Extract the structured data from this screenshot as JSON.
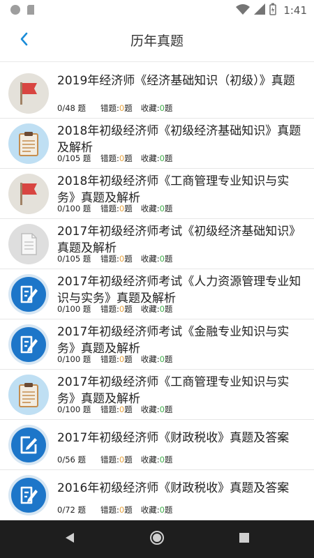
{
  "status": {
    "time": "1:41"
  },
  "header": {
    "title": "历年真题",
    "back_icon": "chevron-left-icon"
  },
  "colors": {
    "accent": "#1a8cd8",
    "wrong": "#e6a23c",
    "fav": "#3fae49",
    "badge_blue": "#1d76c9"
  },
  "labels": {
    "wrong": "错题:",
    "fav": "收藏:",
    "unit": "题"
  },
  "items": [
    {
      "icon": "flag-icon",
      "title": "2019年经济师《经济基础知识（初级）》真题",
      "count": "0/48 题",
      "wrong": "0",
      "fav": "0"
    },
    {
      "icon": "clipboard-icon",
      "title": "2018年初级经济师《初级经济基础知识》真题及解析",
      "count": "0/105 题",
      "wrong": "0",
      "fav": "0"
    },
    {
      "icon": "flag-icon",
      "title": "2018年初级经济师《工商管理专业知识与实务》真题及解析",
      "count": "0/100 题",
      "wrong": "0",
      "fav": "0"
    },
    {
      "icon": "document-icon",
      "title": "2017年初级经济师考试《初级经济基础知识》真题及解析",
      "count": "0/105 题",
      "wrong": "0",
      "fav": "0"
    },
    {
      "icon": "edit-icon",
      "title": "2017年初级经济师考试《人力资源管理专业知识与实务》真题及解析",
      "count": "0/100 题",
      "wrong": "0",
      "fav": "0"
    },
    {
      "icon": "edit-icon",
      "title": "2017年初级经济师考试《金融专业知识与实务》真题及解析",
      "count": "0/100 题",
      "wrong": "0",
      "fav": "0"
    },
    {
      "icon": "clipboard-icon",
      "title": "2017年初级经济师《工商管理专业知识与实务》真题及解析",
      "count": "0/100 题",
      "wrong": "0",
      "fav": "0"
    },
    {
      "icon": "edit-square-icon",
      "title": "2017年初级经济师《财政税收》真题及答案",
      "count": "0/56 题",
      "wrong": "0",
      "fav": "0"
    },
    {
      "icon": "edit-icon",
      "title": "2016年初级经济师《财政税收》真题及答案",
      "count": "0/72 题",
      "wrong": "0",
      "fav": "0"
    }
  ]
}
